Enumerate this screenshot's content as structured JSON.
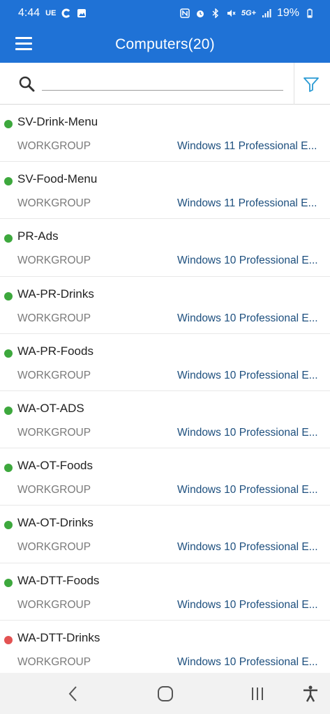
{
  "status_bar": {
    "time": "4:44",
    "carrier": "UE",
    "network": "5G+",
    "battery": "19%"
  },
  "header": {
    "title": "Computers(20)"
  },
  "search": {
    "value": "",
    "placeholder": ""
  },
  "colors": {
    "primary": "#1f72d6",
    "online": "#3da83d",
    "offline": "#e35252",
    "os_text": "#1d4f7e"
  },
  "computers": [
    {
      "name": "SV-Drink-Menu",
      "group": "WORKGROUP",
      "os": "Windows 11 Professional E...",
      "status": "online"
    },
    {
      "name": "SV-Food-Menu",
      "group": "WORKGROUP",
      "os": "Windows 11 Professional E...",
      "status": "online"
    },
    {
      "name": "PR-Ads",
      "group": "WORKGROUP",
      "os": "Windows 10 Professional E...",
      "status": "online"
    },
    {
      "name": "WA-PR-Drinks",
      "group": "WORKGROUP",
      "os": "Windows 10 Professional E...",
      "status": "online"
    },
    {
      "name": "WA-PR-Foods",
      "group": "WORKGROUP",
      "os": "Windows 10 Professional E...",
      "status": "online"
    },
    {
      "name": "WA-OT-ADS",
      "group": "WORKGROUP",
      "os": "Windows 10 Professional E...",
      "status": "online"
    },
    {
      "name": "WA-OT-Foods",
      "group": "WORKGROUP",
      "os": "Windows 10 Professional E...",
      "status": "online"
    },
    {
      "name": "WA-OT-Drinks",
      "group": "WORKGROUP",
      "os": "Windows 10 Professional E...",
      "status": "online"
    },
    {
      "name": "WA-DTT-Foods",
      "group": "WORKGROUP",
      "os": "Windows 10 Professional E...",
      "status": "online"
    },
    {
      "name": "WA-DTT-Drinks",
      "group": "WORKGROUP",
      "os": "Windows 10 Professional E...",
      "status": "offline"
    }
  ],
  "icons": {
    "menu": "hamburger-menu-icon",
    "search": "search-icon",
    "filter": "filter-icon",
    "back": "back-chevron-icon",
    "home": "home-icon",
    "recents": "recent-apps-icon",
    "accessibility": "accessibility-icon"
  }
}
